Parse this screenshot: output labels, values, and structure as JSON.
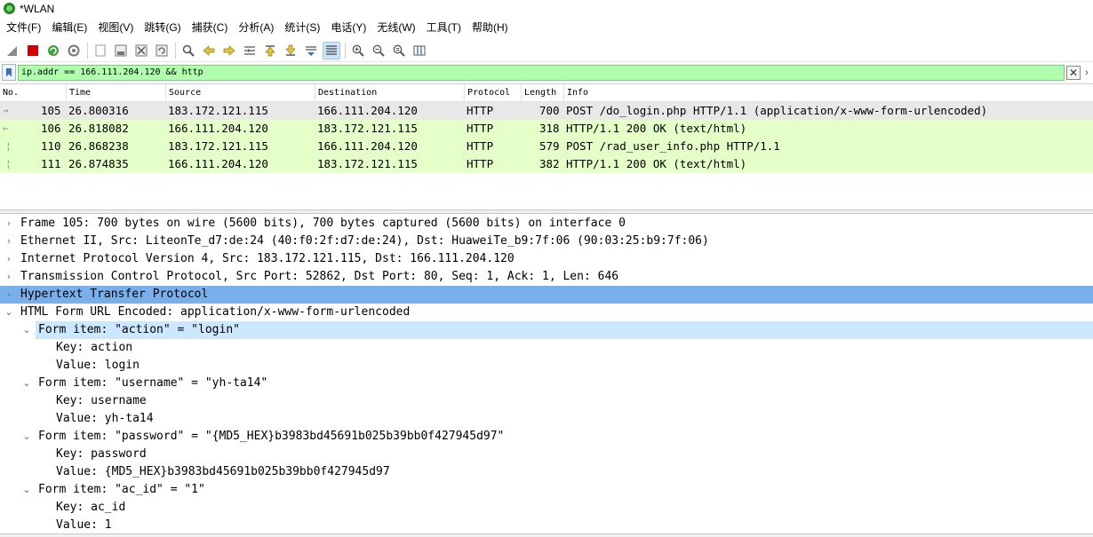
{
  "window": {
    "title": "*WLAN"
  },
  "menu": [
    "文件(F)",
    "编辑(E)",
    "视图(V)",
    "跳转(G)",
    "捕获(C)",
    "分析(A)",
    "统计(S)",
    "电话(Y)",
    "无线(W)",
    "工具(T)",
    "帮助(H)"
  ],
  "toolbar": {
    "icons": [
      "shark-fin-icon",
      "stop-capture-icon",
      "restart-capture-icon",
      "capture-options-icon",
      "open-file-icon",
      "save-file-icon",
      "close-file-icon",
      "reload-file-icon",
      "find-packet-icon",
      "go-back-icon",
      "go-forward-icon",
      "go-to-packet-icon",
      "go-first-icon",
      "go-last-icon",
      "autoscroll-icon",
      "colorize-icon",
      "zoom-in-icon",
      "zoom-out-icon",
      "zoom-normal-icon",
      "resize-columns-icon"
    ]
  },
  "filter": {
    "value": "ip.addr == 166.111.204.120 && http"
  },
  "packet_list": {
    "columns": [
      "No.",
      "Time",
      "Source",
      "Destination",
      "Protocol",
      "Length",
      "Info"
    ],
    "rows": [
      {
        "no": "105",
        "time": "26.800316",
        "source": "183.172.121.115",
        "destination": "166.111.204.120",
        "protocol": "HTTP",
        "length": "700",
        "info": "POST /do_login.php HTTP/1.1  (application/x-www-form-urlencoded)",
        "marker": "→"
      },
      {
        "no": "106",
        "time": "26.818082",
        "source": "166.111.204.120",
        "destination": "183.172.121.115",
        "protocol": "HTTP",
        "length": "318",
        "info": "HTTP/1.1 200 OK  (text/html)",
        "marker": "←"
      },
      {
        "no": "110",
        "time": "26.868238",
        "source": "183.172.121.115",
        "destination": "166.111.204.120",
        "protocol": "HTTP",
        "length": "579",
        "info": "POST /rad_user_info.php HTTP/1.1",
        "marker": ""
      },
      {
        "no": "111",
        "time": "26.874835",
        "source": "166.111.204.120",
        "destination": "183.172.121.115",
        "protocol": "HTTP",
        "length": "382",
        "info": "HTTP/1.1 200 OK  (text/html)",
        "marker": ""
      }
    ]
  },
  "details": [
    {
      "text": "Frame 105: 700 bytes on wire (5600 bits), 700 bytes captured (5600 bits) on interface 0",
      "level": 0,
      "expander": "›"
    },
    {
      "text": "Ethernet II, Src: LiteonTe_d7:de:24 (40:f0:2f:d7:de:24), Dst: HuaweiTe_b9:7f:06 (90:03:25:b9:7f:06)",
      "level": 0,
      "expander": "›"
    },
    {
      "text": "Internet Protocol Version 4, Src: 183.172.121.115, Dst: 166.111.204.120",
      "level": 0,
      "expander": "›"
    },
    {
      "text": "Transmission Control Protocol, Src Port: 52862, Dst Port: 80, Seq: 1, Ack: 1, Len: 646",
      "level": 0,
      "expander": "›"
    },
    {
      "text": "Hypertext Transfer Protocol",
      "level": 0,
      "expander": "›"
    },
    {
      "text": "HTML Form URL Encoded: application/x-www-form-urlencoded",
      "level": 0,
      "expander": "⌄"
    },
    {
      "text": "Form item: \"action\" = \"login\"",
      "level": 1,
      "expander": "⌄"
    },
    {
      "text": "Key: action",
      "level": 2,
      "expander": ""
    },
    {
      "text": "Value: login",
      "level": 2,
      "expander": ""
    },
    {
      "text": "Form item: \"username\" = \"yh-ta14\"",
      "level": 1,
      "expander": "⌄"
    },
    {
      "text": "Key: username",
      "level": 2,
      "expander": ""
    },
    {
      "text": "Value: yh-ta14",
      "level": 2,
      "expander": ""
    },
    {
      "text": "Form item: \"password\" = \"{MD5_HEX}b3983bd45691b025b39bb0f427945d97\"",
      "level": 1,
      "expander": "⌄"
    },
    {
      "text": "Key: password",
      "level": 2,
      "expander": ""
    },
    {
      "text": "Value: {MD5_HEX}b3983bd45691b025b39bb0f427945d97",
      "level": 2,
      "expander": ""
    },
    {
      "text": "Form item: \"ac_id\" = \"1\"",
      "level": 1,
      "expander": "⌄"
    },
    {
      "text": "Key: ac_id",
      "level": 2,
      "expander": ""
    },
    {
      "text": "Value: 1",
      "level": 2,
      "expander": ""
    }
  ],
  "colors": {
    "http_row": "#e4ffc7",
    "selected_row": "#e8e8e8",
    "selected_detail": "#79b0ec",
    "filter_valid": "#afffaf"
  }
}
